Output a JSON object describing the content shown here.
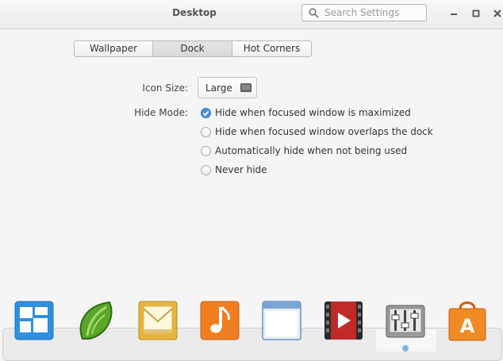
{
  "window": {
    "title": "Desktop",
    "search_placeholder": "Search Settings"
  },
  "tabs": [
    {
      "label": "Wallpaper",
      "selected": false
    },
    {
      "label": "Dock",
      "selected": true
    },
    {
      "label": "Hot Corners",
      "selected": false
    }
  ],
  "icon_size": {
    "label": "Icon Size:",
    "value": "Large"
  },
  "hide_mode": {
    "label": "Hide Mode:",
    "options": [
      {
        "label": "Hide when focused window is maximized",
        "selected": true
      },
      {
        "label": "Hide when focused window overlaps the dock",
        "selected": false
      },
      {
        "label": "Automatically hide when not being used",
        "selected": false
      },
      {
        "label": "Never hide",
        "selected": false
      }
    ]
  },
  "dock": {
    "items": [
      {
        "icon": "multitasking-view-icon",
        "color": "#2f8fe0"
      },
      {
        "icon": "midori-browser-icon",
        "color": "#5aa62b"
      },
      {
        "icon": "mail-icon",
        "color": "#e6b53a"
      },
      {
        "icon": "music-icon",
        "color": "#f07d22"
      },
      {
        "icon": "files-window-icon",
        "color": "#5f8fc7"
      },
      {
        "icon": "video-player-icon",
        "color": "#c22a2a"
      },
      {
        "icon": "system-settings-icon",
        "color": "#7c7c7c"
      },
      {
        "icon": "app-center-icon",
        "color": "#f08a24"
      }
    ],
    "active_index": 6
  }
}
